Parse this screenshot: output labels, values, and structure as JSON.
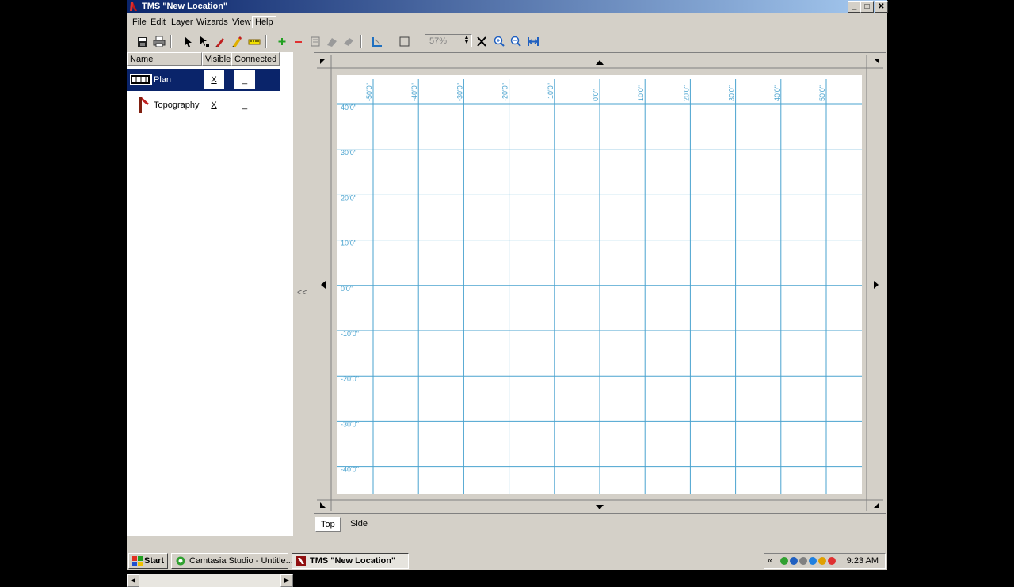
{
  "window": {
    "title": "TMS \"New Location\"",
    "min_glyph": "_",
    "max_glyph": "□",
    "close_glyph": "✕"
  },
  "menu": [
    "File",
    "Edit",
    "Layer",
    "Wizards",
    "View",
    "Help"
  ],
  "toolbar": {
    "zoom_value": "57%"
  },
  "layers_panel": {
    "columns": {
      "name": "Name",
      "visible": "Visible",
      "connected": "Connected"
    },
    "rows": [
      {
        "name": "Plan",
        "visible": "X",
        "connected": "_",
        "selected": true
      },
      {
        "name": "Topography",
        "visible": "X",
        "connected": "_",
        "selected": false
      }
    ]
  },
  "splitter": {
    "collapse_glyph": "<<"
  },
  "plan_view": {
    "x_ticks": [
      "-50'0\"",
      "-40'0\"",
      "-30'0\"",
      "-20'0\"",
      "-10'0\"",
      "0'0\"",
      "10'0\"",
      "20'0\"",
      "30'0\"",
      "40'0\"",
      "50'0\""
    ],
    "y_ticks": [
      "40'0\"",
      "30'0\"",
      "20'0\"",
      "10'0\"",
      "0'0\"",
      "-10'0\"",
      "-20'0\"",
      "-30'0\"",
      "-40'0\""
    ],
    "grid_color": "#4aa3cf"
  },
  "view_tabs": [
    "Top",
    "Side"
  ],
  "taskbar": {
    "start": "Start",
    "tasks": [
      "Camtasia Studio - Untitle...",
      "TMS \"New Location\""
    ],
    "tray_chevron": "«",
    "clock": "9:23 AM"
  }
}
